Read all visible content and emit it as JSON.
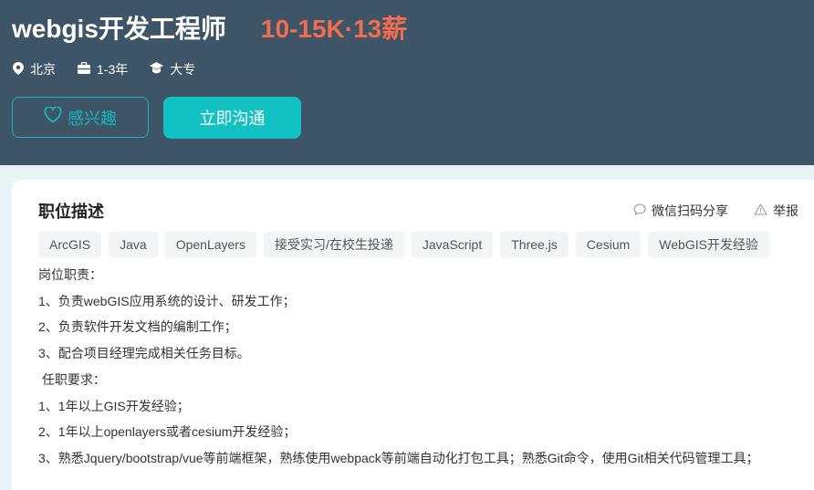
{
  "job": {
    "title": "webgis开发工程师",
    "salary": "10-15K·13薪",
    "meta": {
      "city": "北京",
      "experience": "1-3年",
      "degree": "大专"
    }
  },
  "buttons": {
    "interest": "感兴趣",
    "chat": "立即沟通"
  },
  "description": {
    "section_title": "职位描述",
    "share_label": "微信扫码分享",
    "report_label": "举报",
    "tags": [
      "ArcGIS",
      "Java",
      "OpenLayers",
      "接受实习/在校生投递",
      "JavaScript",
      "Three.js",
      "Cesium",
      "WebGIS开发经验"
    ],
    "lines": [
      "岗位职责：",
      "1、负责webGIS应用系统的设计、研发工作；",
      "2、负责软件开发文档的编制工作；",
      "3、配合项目经理完成相关任务目标。",
      " 任职要求：",
      "1、1年以上GIS开发经验；",
      "2、1年以上openlayers或者cesium开发经验；",
      "3、熟悉Jquery/bootstrap/vue等前端框架，熟练使用webpack等前端自动化打包工具；熟悉Git命令，使用Git相关代码管理工具；"
    ]
  },
  "colors": {
    "header_bg": "#3d5567",
    "salary": "#f26d4f",
    "accent": "#12c1c1"
  }
}
